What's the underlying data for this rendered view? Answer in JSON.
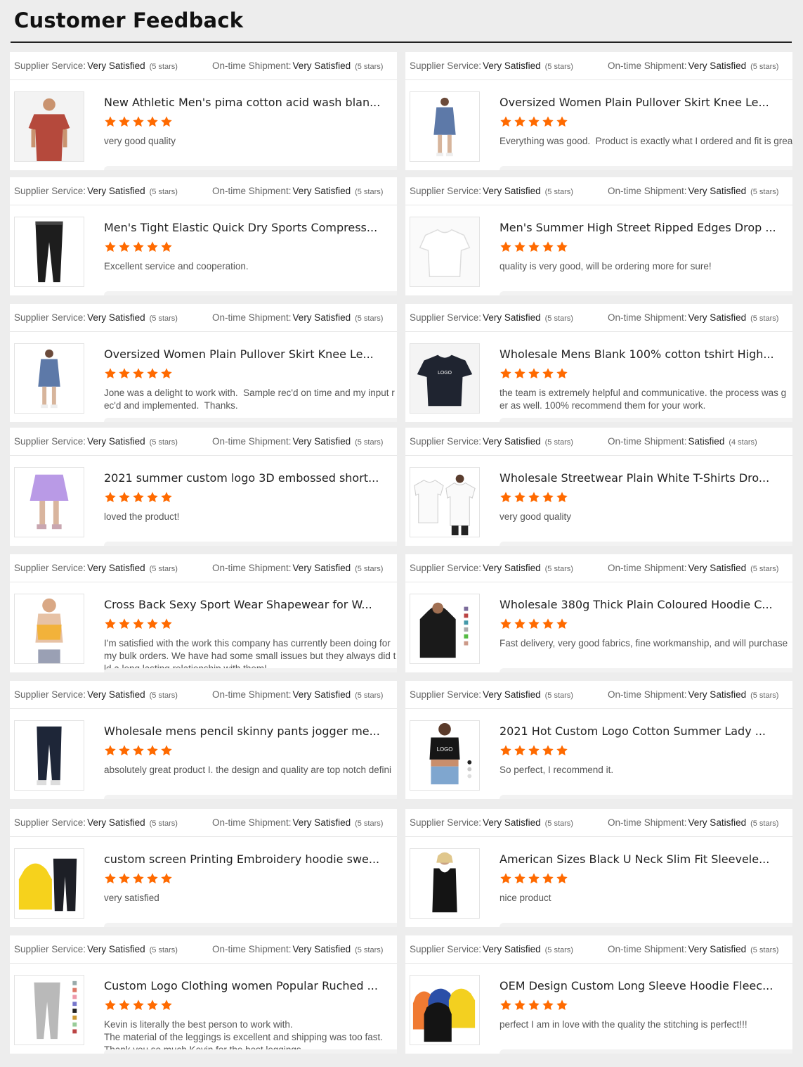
{
  "page": {
    "title": "Customer Feedback"
  },
  "labels": {
    "supplier_service": "Supplier Service:",
    "ontime_shipment": "On-time Shipment:"
  },
  "colors": {
    "star": "#ff6a00",
    "title_rule": "#222222"
  },
  "reviews": [
    {
      "service_rating": "Very Satisfied",
      "service_stars": "(5 stars)",
      "shipment_rating": "Very Satisfied",
      "shipment_stars": "(5 stars)",
      "product_title": "New Athletic Men's pima cotton acid wash blan...",
      "stars": 5,
      "review": "very good quality",
      "image": "red-tshirt-man"
    },
    {
      "service_rating": "Very Satisfied",
      "service_stars": "(5 stars)",
      "shipment_rating": "Very Satisfied",
      "shipment_stars": "(5 stars)",
      "product_title": "Oversized Women Plain Pullover Skirt Knee Le...",
      "stars": 5,
      "review": "Everything was good.  Product is exactly what I ordered and fit is grea",
      "image": "blue-sweater-dress"
    },
    {
      "service_rating": "Very Satisfied",
      "service_stars": "(5 stars)",
      "shipment_rating": "Very Satisfied",
      "shipment_stars": "(5 stars)",
      "product_title": "Men's Tight Elastic Quick Dry Sports Compress...",
      "stars": 5,
      "review": "Excellent service and cooperation.",
      "image": "black-compression-pants"
    },
    {
      "service_rating": "Very Satisfied",
      "service_stars": "(5 stars)",
      "shipment_rating": "Very Satisfied",
      "shipment_stars": "(5 stars)",
      "product_title": "Men's Summer High Street Ripped Edges Drop ...",
      "stars": 5,
      "review": "quality is very good, will be ordering more for sure!",
      "image": "white-tshirt"
    },
    {
      "service_rating": "Very Satisfied",
      "service_stars": "(5 stars)",
      "shipment_rating": "Very Satisfied",
      "shipment_stars": "(5 stars)",
      "product_title": "Oversized Women Plain Pullover Skirt Knee Le...",
      "stars": 5,
      "review": "Jone was a delight to work with.  Sample rec'd on time and my input r\nec'd and implemented.  Thanks.",
      "image": "blue-sweater-dress"
    },
    {
      "service_rating": "Very Satisfied",
      "service_stars": "(5 stars)",
      "shipment_rating": "Very Satisfied",
      "shipment_stars": "(5 stars)",
      "product_title": "Wholesale Mens Blank 100% cotton tshirt High...",
      "stars": 5,
      "review": "the team is extremely helpful and communicative. the process was g\ner as well. 100% recommend them for your work.",
      "image": "navy-logo-tshirt"
    },
    {
      "service_rating": "Very Satisfied",
      "service_stars": "(5 stars)",
      "shipment_rating": "Very Satisfied",
      "shipment_stars": "(5 stars)",
      "product_title": "2021 summer custom logo 3D embossed short...",
      "stars": 5,
      "review": "loved the product!",
      "image": "purple-shorts"
    },
    {
      "service_rating": "Very Satisfied",
      "service_stars": "(5 stars)",
      "shipment_rating": "Satisfied",
      "shipment_stars": "(4 stars)",
      "product_title": "Wholesale Streetwear Plain White T-Shirts Dro...",
      "stars": 5,
      "review": "very good quality",
      "image": "white-tshirts-men"
    },
    {
      "service_rating": "Very Satisfied",
      "service_stars": "(5 stars)",
      "shipment_rating": "Very Satisfied",
      "shipment_stars": "(5 stars)",
      "product_title": "Cross Back Sexy Sport Wear Shapewear for W...",
      "stars": 5,
      "review": "I'm satisfied with the work this company has currently been doing for\nmy bulk orders. We have had some small issues but they always did t\nld a long lasting relationship with them!",
      "image": "yellow-sports-bra"
    },
    {
      "service_rating": "Very Satisfied",
      "service_stars": "(5 stars)",
      "shipment_rating": "Very Satisfied",
      "shipment_stars": "(5 stars)",
      "product_title": "Wholesale 380g Thick Plain Coloured Hoodie C...",
      "stars": 5,
      "review": "Fast delivery, very good fabrics, fine workmanship, and will purchase",
      "image": "black-hoodie"
    },
    {
      "service_rating": "Very Satisfied",
      "service_stars": "(5 stars)",
      "shipment_rating": "Very Satisfied",
      "shipment_stars": "(5 stars)",
      "product_title": "Wholesale mens pencil skinny pants jogger me...",
      "stars": 5,
      "review": "absolutely great product I. the design and quality are top notch defini",
      "image": "navy-joggers"
    },
    {
      "service_rating": "Very Satisfied",
      "service_stars": "(5 stars)",
      "shipment_rating": "Very Satisfied",
      "shipment_stars": "(5 stars)",
      "product_title": "2021 Hot Custom Logo Cotton Summer Lady ...",
      "stars": 5,
      "review": "So perfect, I recommend it.",
      "image": "black-crop-top"
    },
    {
      "service_rating": "Very Satisfied",
      "service_stars": "(5 stars)",
      "shipment_rating": "Very Satisfied",
      "shipment_stars": "(5 stars)",
      "product_title": "custom screen Printing Embroidery hoodie swe...",
      "stars": 5,
      "review": "very satisfied",
      "image": "yellow-hoodie-set"
    },
    {
      "service_rating": "Very Satisfied",
      "service_stars": "(5 stars)",
      "shipment_rating": "Very Satisfied",
      "shipment_stars": "(5 stars)",
      "product_title": "American Sizes Black U Neck Slim Fit Sleevele...",
      "stars": 5,
      "review": "nice product",
      "image": "black-tank-top"
    },
    {
      "service_rating": "Very Satisfied",
      "service_stars": "(5 stars)",
      "shipment_rating": "Very Satisfied",
      "shipment_stars": "(5 stars)",
      "product_title": "Custom Logo Clothing women Popular Ruched ...",
      "stars": 5,
      "review": "Kevin is literally the best person to work with.\nThe material of the leggings is excellent and shipping was too fast.\nThank you so much Kevin for the best leggings",
      "image": "grey-leggings"
    },
    {
      "service_rating": "Very Satisfied",
      "service_stars": "(5 stars)",
      "shipment_rating": "Very Satisfied",
      "shipment_stars": "(5 stars)",
      "product_title": "OEM Design Custom Long Sleeve Hoodie Fleec...",
      "stars": 5,
      "review": "perfect I am in love with the quality the stitching is perfect!!!",
      "image": "color-hoodies"
    }
  ]
}
